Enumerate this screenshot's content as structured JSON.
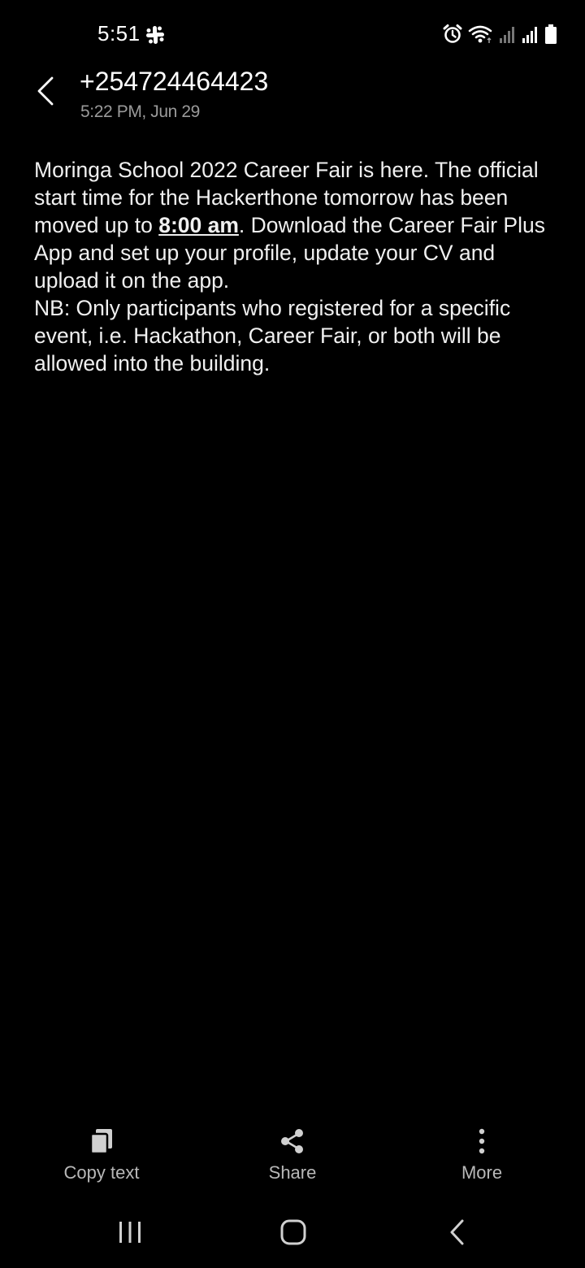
{
  "status_bar": {
    "time": "5:51",
    "icons": [
      "slack-icon",
      "alarm-icon",
      "wifi-icon",
      "signal-icon",
      "signal-icon",
      "battery-icon"
    ]
  },
  "header": {
    "back_icon": "chevron-left-icon",
    "sender": "+254724464423",
    "timestamp": "5:22 PM, Jun 29"
  },
  "message": {
    "part1": "Moringa School 2022 Career Fair is here. The official start time for the Hackerthone tomorrow has been moved up to ",
    "highlight": "8:00 am",
    "part2": ". Download the Career Fair Plus App and set up your profile, update your CV and upload it on the app.\nNB: Only participants who registered for a specific event, i.e. Hackathon, Career Fair, or both will be allowed into the building."
  },
  "actions": [
    {
      "label": "Copy text",
      "icon": "copy-icon"
    },
    {
      "label": "Share",
      "icon": "share-icon"
    },
    {
      "label": "More",
      "icon": "more-vertical-icon"
    }
  ],
  "navbar": {
    "icons": [
      "recent-apps-icon",
      "home-icon",
      "back-icon"
    ]
  },
  "colors": {
    "background": "#000000",
    "text": "#f0f0f0",
    "secondary_text": "#9a9a9a",
    "icon": "#d0d0d0"
  }
}
